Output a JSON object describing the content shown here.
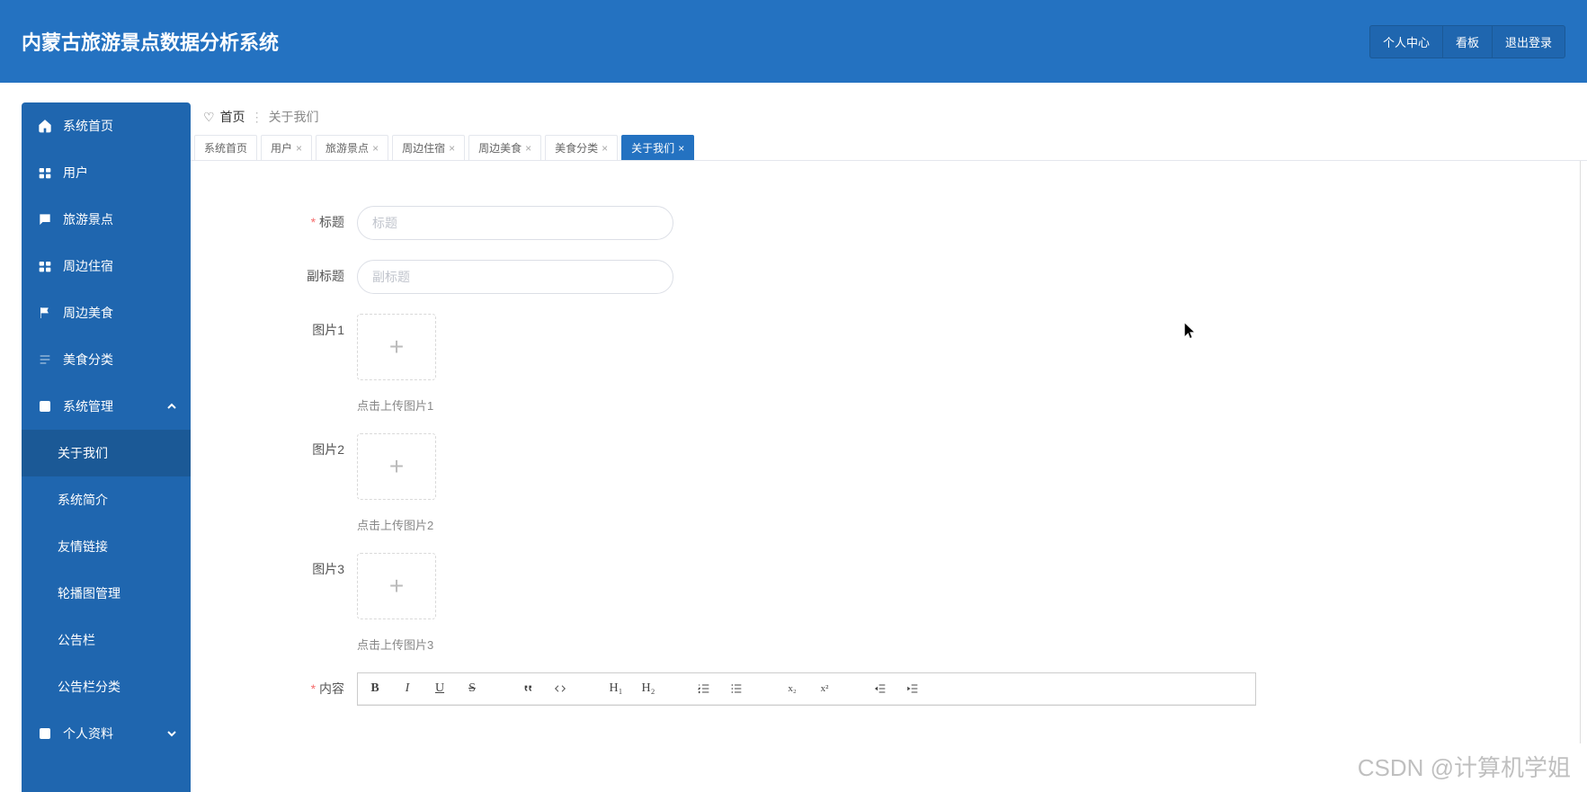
{
  "app": {
    "title": "内蒙古旅游景点数据分析系统"
  },
  "topbar": {
    "profile": "个人中心",
    "board": "看板",
    "logout": "退出登录"
  },
  "sidebar": {
    "items": [
      {
        "icon": "home",
        "label": "系统首页"
      },
      {
        "icon": "users",
        "label": "用户"
      },
      {
        "icon": "spot",
        "label": "旅游景点"
      },
      {
        "icon": "stay",
        "label": "周边住宿"
      },
      {
        "icon": "food",
        "label": "周边美食"
      },
      {
        "icon": "cat",
        "label": "美食分类"
      },
      {
        "icon": "sys",
        "label": "系统管理",
        "expanded": true
      },
      {
        "sub": true,
        "label": "关于我们",
        "selected": true
      },
      {
        "sub": true,
        "label": "系统简介"
      },
      {
        "sub": true,
        "label": "友情链接"
      },
      {
        "sub": true,
        "label": "轮播图管理"
      },
      {
        "sub": true,
        "label": "公告栏"
      },
      {
        "sub": true,
        "label": "公告栏分类"
      },
      {
        "icon": "me",
        "label": "个人资料",
        "expandable": true
      }
    ]
  },
  "breadcrumb": {
    "home": "首页",
    "current": "关于我们"
  },
  "tabs": [
    {
      "label": "系统首页",
      "closable": false
    },
    {
      "label": "用户",
      "closable": true
    },
    {
      "label": "旅游景点",
      "closable": true
    },
    {
      "label": "周边住宿",
      "closable": true
    },
    {
      "label": "周边美食",
      "closable": true
    },
    {
      "label": "美食分类",
      "closable": true
    },
    {
      "label": "关于我们",
      "closable": true,
      "active": true
    }
  ],
  "form": {
    "title": {
      "label": "标题",
      "placeholder": "标题",
      "value": ""
    },
    "subtitle": {
      "label": "副标题",
      "placeholder": "副标题",
      "value": ""
    },
    "img1": {
      "label": "图片1",
      "hint": "点击上传图片1"
    },
    "img2": {
      "label": "图片2",
      "hint": "点击上传图片2"
    },
    "img3": {
      "label": "图片3",
      "hint": "点击上传图片3"
    },
    "content": {
      "label": "内容"
    }
  },
  "editor": {
    "bold": "B",
    "italic": "I",
    "under": "U",
    "strike": "S",
    "h1": "H₁",
    "h2": "H₂",
    "sub": "x₂",
    "sup": "x²"
  },
  "watermark": "CSDN @计算机学姐"
}
